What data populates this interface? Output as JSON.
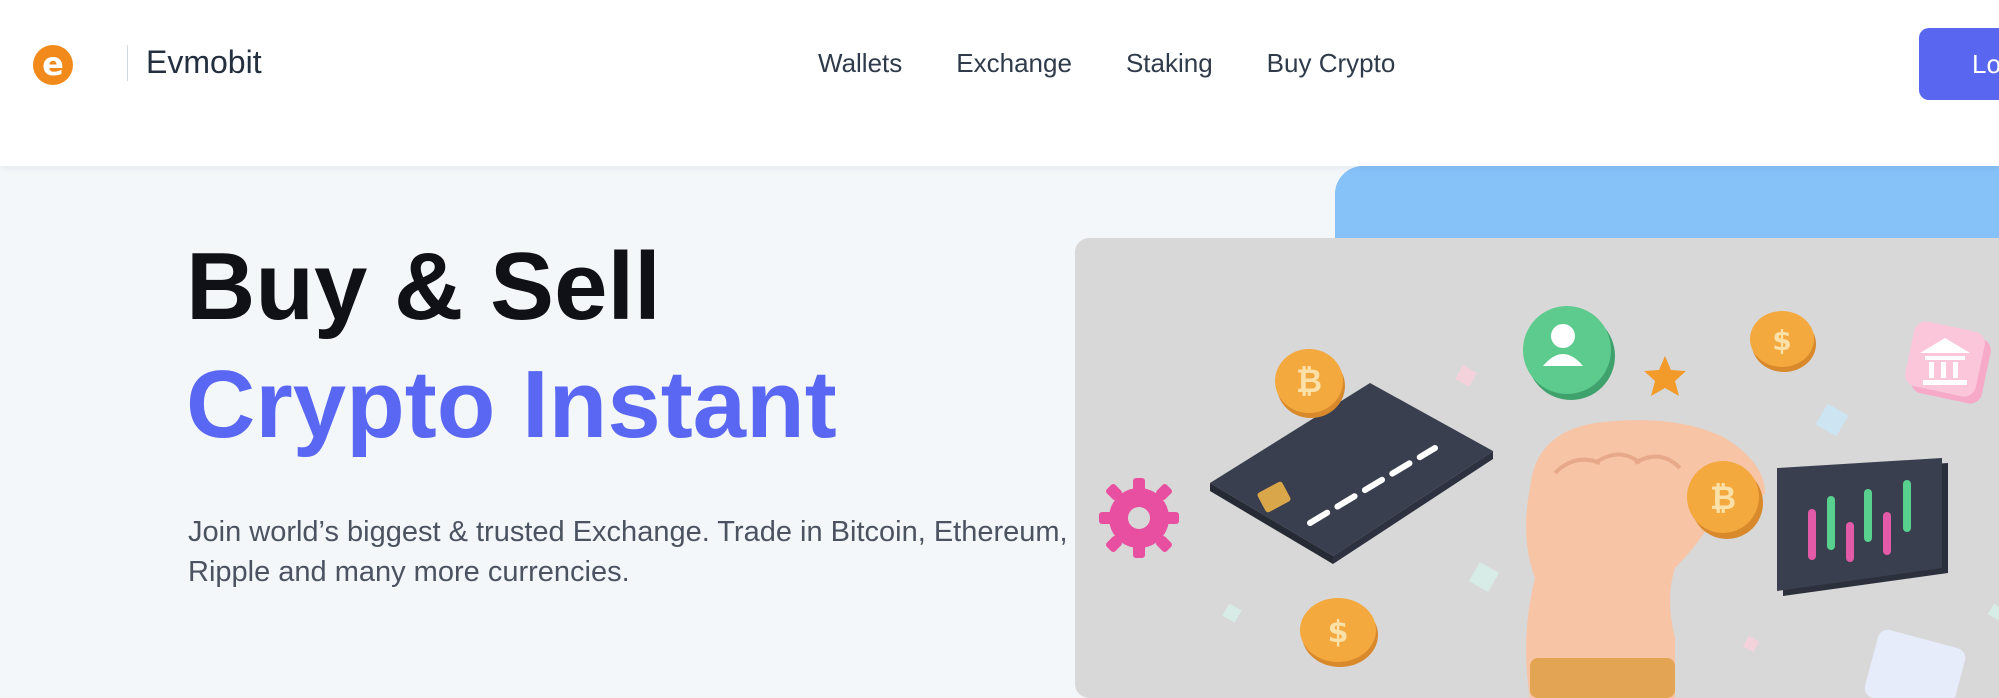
{
  "header": {
    "logo_letter": "e",
    "brand": "Evmobit",
    "nav": [
      "Wallets",
      "Exchange",
      "Staking",
      "Buy Crypto"
    ],
    "login_label": "Lo"
  },
  "hero": {
    "title_line1": "Buy & Sell",
    "title_line2": "Crypto Instant",
    "description": "Join world’s biggest & trusted Exchange. Trade in Bitcoin, Ethereum, Ripple and many more currencies."
  },
  "illustration": {
    "coin_bitcoin_symbol": "₿",
    "coin_dollar_symbol": "$",
    "colors": {
      "card": "#3a3f4f",
      "coin": "#f2a33a",
      "gear": "#e94fa0",
      "avatar_coin": "#55c98a",
      "chart_bg": "#353a49",
      "hand": "#f7c4a6"
    }
  }
}
